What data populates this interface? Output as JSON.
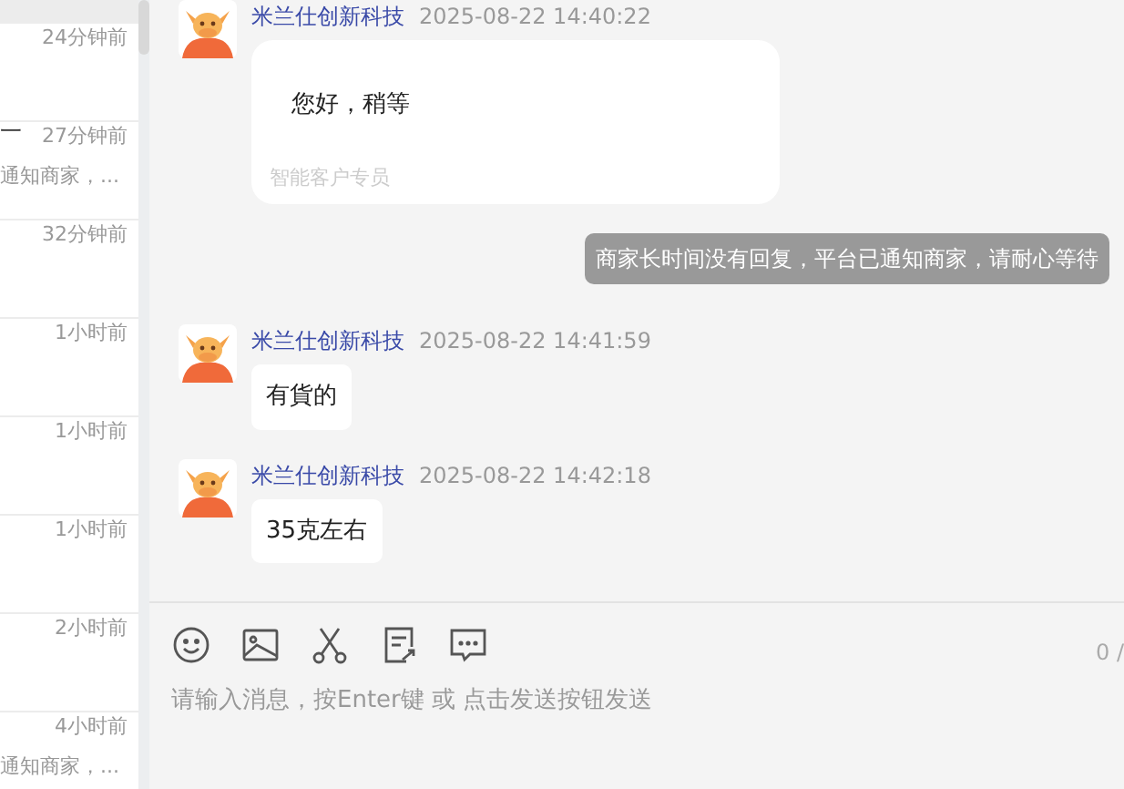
{
  "conversations": [
    {
      "selected": true
    },
    {
      "time": "24分钟前",
      "selected": false
    },
    {
      "name": "一",
      "time": "27分钟前",
      "preview": "通知商家，...",
      "selected": false
    },
    {
      "time": "32分钟前",
      "selected": false
    },
    {
      "time": "1小时前",
      "selected": false
    },
    {
      "time": "1小时前",
      "selected": false
    },
    {
      "time": "1小时前",
      "selected": false
    },
    {
      "time": "2小时前",
      "selected": false
    },
    {
      "time": "4小时前",
      "preview": "通知商家，...",
      "selected": false
    }
  ],
  "messages": [
    {
      "kind": "message",
      "sender": "米兰仕创新科技",
      "time": "2025-08-22 14:40:22",
      "text": "您好，稍等",
      "role": "智能客户专员"
    },
    {
      "kind": "notice",
      "text": "商家长时间没有回复，平台已通知商家，请耐心等待"
    },
    {
      "kind": "message",
      "sender": "米兰仕创新科技",
      "time": "2025-08-22 14:41:59",
      "text": "有貨的"
    },
    {
      "kind": "message",
      "sender": "米兰仕创新科技",
      "time": "2025-08-22 14:42:18",
      "text": "35克左右"
    }
  ],
  "composer": {
    "tools": [
      {
        "kind": "emoji"
      },
      {
        "kind": "image"
      },
      {
        "kind": "scissors"
      },
      {
        "kind": "note"
      },
      {
        "kind": "comment"
      }
    ],
    "counter": "0 /",
    "placeholder": "请输入消息，按Enter键 或 点击发送按钮发送"
  }
}
